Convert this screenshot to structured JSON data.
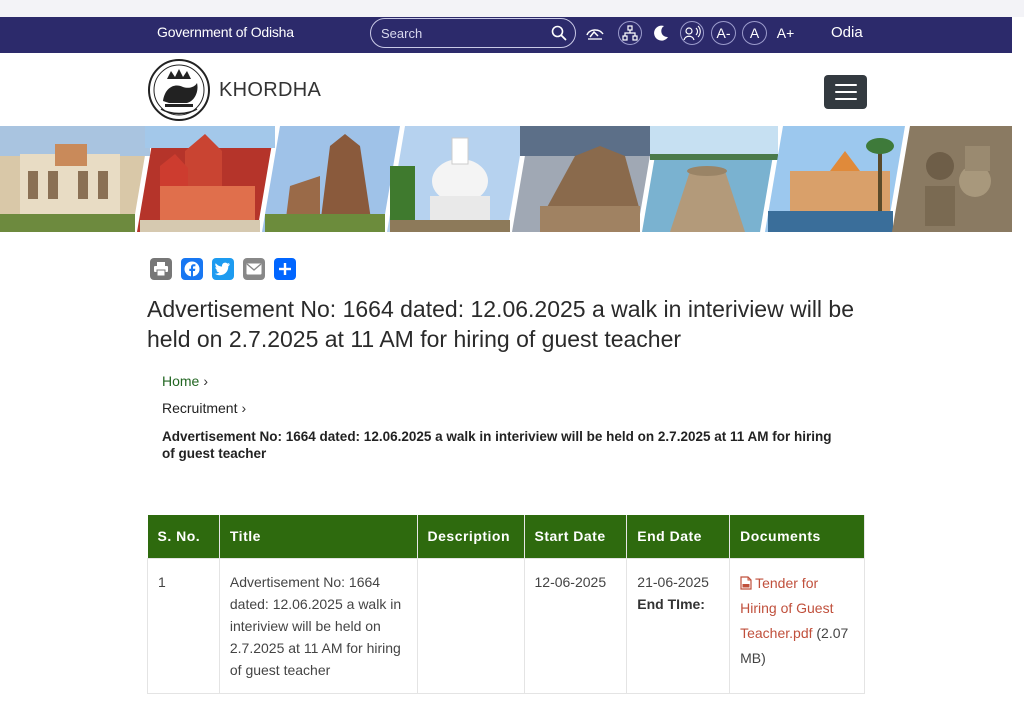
{
  "topbar": {
    "gov_title": "Government of Odisha",
    "search_placeholder": "Search",
    "font_decrease": "A-",
    "font_normal": "A",
    "font_increase": "A+",
    "language": "Odia",
    "bg_color": "#2c2a6b"
  },
  "header": {
    "site_name": "KHORDHA"
  },
  "share": {
    "icons": [
      "print-icon",
      "facebook-icon",
      "twitter-icon",
      "email-icon",
      "share-icon"
    ]
  },
  "page": {
    "title": "Advertisement No: 1664 dated: 12.06.2025 a walk in interiview will be held on 2.7.2025 at 11 AM for hiring of guest teacher"
  },
  "breadcrumb": {
    "home": "Home",
    "section": "Recruitment",
    "current": "Advertisement No: 1664 dated: 12.06.2025 a walk in interiview will be held on 2.7.2025 at 11 AM for hiring of guest teacher"
  },
  "table": {
    "header_color": "#2e6a0e",
    "columns": [
      "S. No.",
      "Title",
      "Description",
      "Start Date",
      "End Date",
      "Documents"
    ],
    "rows": [
      {
        "sno": "1",
        "title": "Advertisement No: 1664 dated: 12.06.2025 a walk in interiview will be held on 2.7.2025 at 11 AM for hiring of guest teacher",
        "description": "",
        "start_date": "12-06-2025",
        "end_date": "21-06-2025",
        "end_time_label": "End TIme:",
        "doc_link": "Tender for Hiring of Guest Teacher.pdf",
        "doc_size": "(2.07 MB)"
      }
    ]
  }
}
